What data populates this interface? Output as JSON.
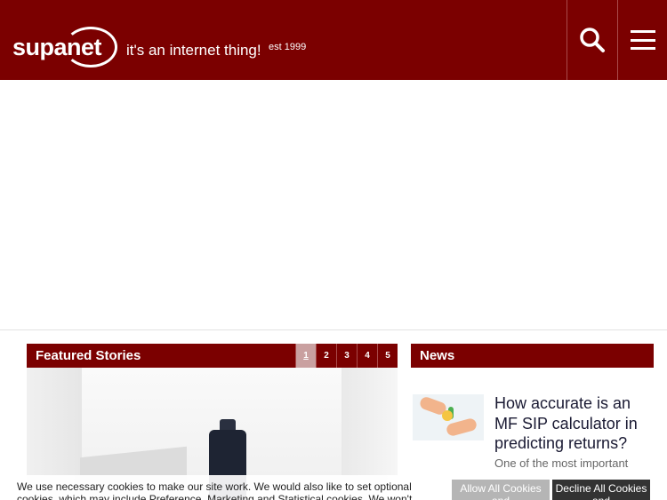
{
  "header": {
    "logo_text": "supanet",
    "tagline": "it's an internet thing!",
    "est": "est 1999",
    "search_icon": "search-icon",
    "menu_icon": "hamburger-menu-icon",
    "background_color": "#7b0000"
  },
  "featured": {
    "title": "Featured Stories",
    "pages": [
      "1",
      "2",
      "3",
      "4",
      "5"
    ],
    "active_page": "1"
  },
  "news": {
    "title": "News",
    "items": [
      {
        "headline": "How accurate is an MF SIP calculator in predicting returns?",
        "snippet": "One of the most important"
      }
    ]
  },
  "cookie_banner": {
    "text": "We use necessary cookies to make our site work. We would also like to set optional cookies, which may include Preference, Marketing and Statistical cookies. We won't",
    "allow_label": "Allow All Cookies and",
    "decline_label": "Decline All Cookies and"
  }
}
